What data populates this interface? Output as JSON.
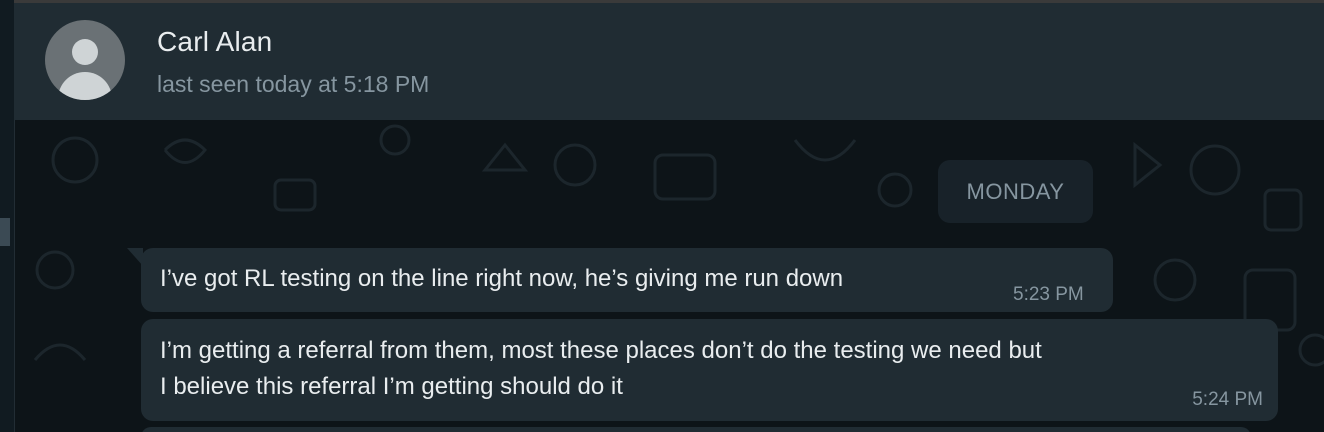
{
  "header": {
    "contact_name": "Carl Alan",
    "last_seen": "last seen today at 5:18 PM",
    "avatar_icon": "default-user-avatar-icon"
  },
  "chat": {
    "date_divider": "MONDAY",
    "messages": [
      {
        "lines": [
          "I’ve got RL testing on the line right now, he’s giving me run down"
        ],
        "time": "5:23 PM",
        "direction": "incoming"
      },
      {
        "lines": [
          "I’m getting a referral from them, most these places don’t do the testing we need but",
          "I believe this referral I’m getting should do it"
        ],
        "time": "5:24 PM",
        "direction": "incoming"
      }
    ]
  },
  "colors": {
    "header_bg": "#202c33",
    "chat_bg": "#0d1418",
    "bubble_bg": "#202c33",
    "primary_text": "#e9edef",
    "secondary_text": "#8696a0"
  }
}
